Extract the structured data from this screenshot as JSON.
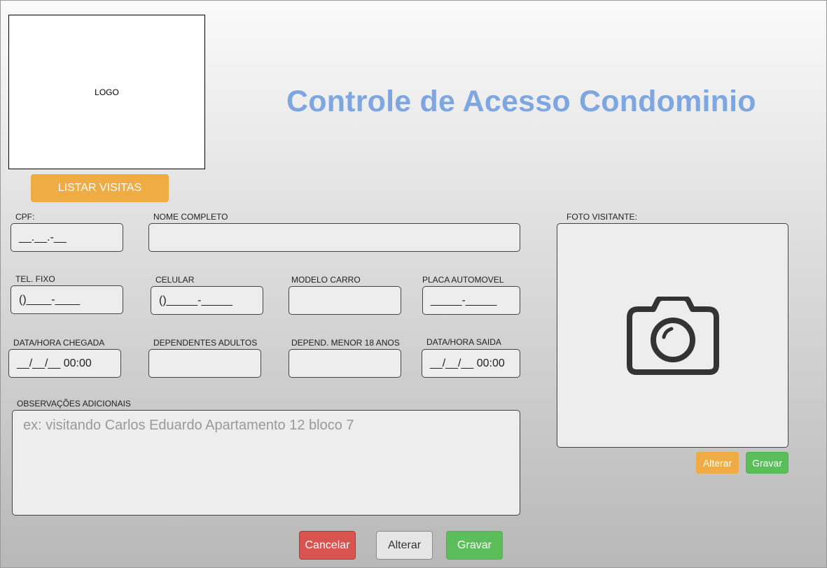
{
  "header": {
    "logo_text": "LOGO",
    "title": "Controle de Acesso Condominio",
    "list_button": "LISTAR VISITAS"
  },
  "form": {
    "cpf": {
      "label": "CPF:",
      "mask": "__.__.-__"
    },
    "nome": {
      "label": "NOME COMPLETO",
      "value": ""
    },
    "tel_fixo": {
      "label": "TEL. FIXO",
      "mask": "()____-____"
    },
    "celular": {
      "label": "CELULAR",
      "mask": "()_____-_____"
    },
    "modelo_carro": {
      "label": "MODELO CARRO",
      "value": ""
    },
    "placa": {
      "label": "PLACA AUTOMOVEL",
      "mask": "_____-_____"
    },
    "chegada": {
      "label": "DATA/HORA CHEGADA",
      "mask": "__/__/__  00:00"
    },
    "dep_adultos": {
      "label": "DEPENDENTES ADULTOS",
      "value": ""
    },
    "dep_menores": {
      "label": "DEPEND.  MENOR 18 ANOS",
      "value": ""
    },
    "saida": {
      "label": "DATA/HORA SAIDA",
      "mask": "__/__/__ 00:00"
    },
    "obs": {
      "label": "OBSERVAÇÕES ADICIONAIS",
      "placeholder": "ex: visitando Carlos Eduardo Apartamento 12 bloco 7"
    }
  },
  "photo": {
    "label": "FOTO VISITANTE:",
    "icon": "camera-icon",
    "alter_button": "Alterar",
    "save_button": "Gravar"
  },
  "actions": {
    "cancel": "Cancelar",
    "alter": "Alterar",
    "save": "Gravar"
  },
  "colors": {
    "title": "#7ea6e0",
    "orange": "#f0ac44",
    "green": "#5bbe5b",
    "red": "#d9534f"
  }
}
